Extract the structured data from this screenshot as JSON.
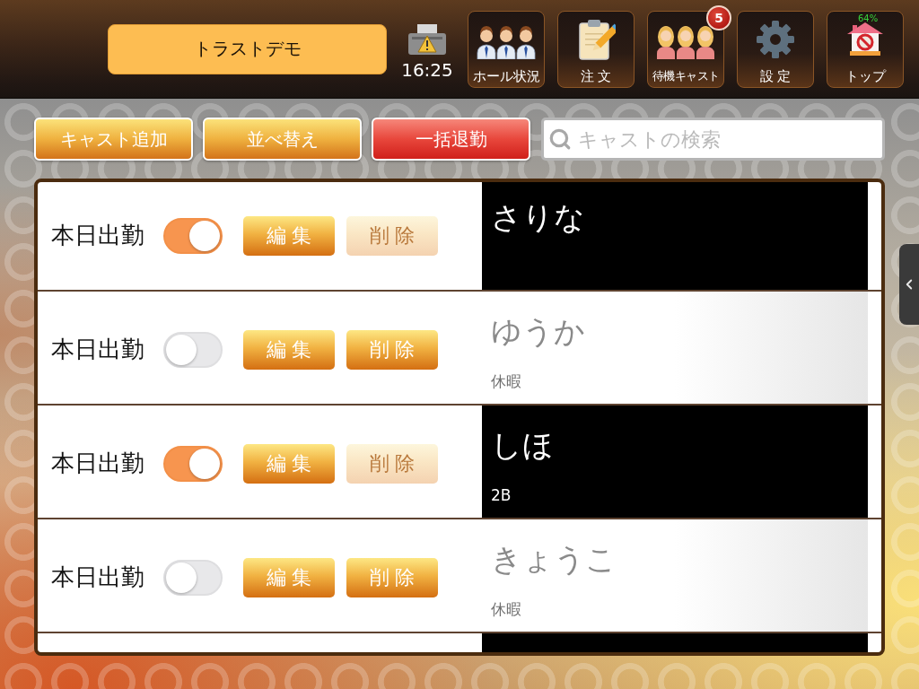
{
  "header": {
    "store_name": "トラストデモ",
    "time": "16:25",
    "nav": [
      {
        "kind": "hall",
        "label": "ホール状況"
      },
      {
        "kind": "order",
        "label": "注 文"
      },
      {
        "kind": "waiting",
        "label": "待機キャスト",
        "badge": "5"
      },
      {
        "kind": "settings",
        "label": "設 定"
      },
      {
        "kind": "top",
        "label": "トップ",
        "overlay_text": "64%"
      }
    ]
  },
  "toolbar": {
    "buttons": [
      {
        "kind": "normal",
        "label": "キャスト追加"
      },
      {
        "kind": "normal",
        "label": "並べ替え"
      },
      {
        "kind": "danger",
        "label": "一括退勤"
      }
    ],
    "search": {
      "placeholder": "キャストの検索"
    }
  },
  "cast_rows": [
    {
      "attendance_label": "本日出勤",
      "on": true,
      "edit_label": "編集",
      "delete": {
        "label": "削除",
        "disabled": true
      },
      "name": "さりな"
    },
    {
      "attendance_label": "本日出勤",
      "on": false,
      "edit_label": "編集",
      "delete": {
        "label": "削除",
        "disabled": false
      },
      "name": "ゆうか",
      "note": "休暇"
    },
    {
      "attendance_label": "本日出勤",
      "on": true,
      "edit_label": "編集",
      "delete": {
        "label": "削除",
        "disabled": true
      },
      "name": "しほ",
      "note": "2B"
    },
    {
      "attendance_label": "本日出勤",
      "on": false,
      "edit_label": "編集",
      "delete": {
        "label": "削除",
        "disabled": false
      },
      "name": "きょうこ",
      "note": "休暇"
    },
    {
      "on": true
    }
  ]
}
